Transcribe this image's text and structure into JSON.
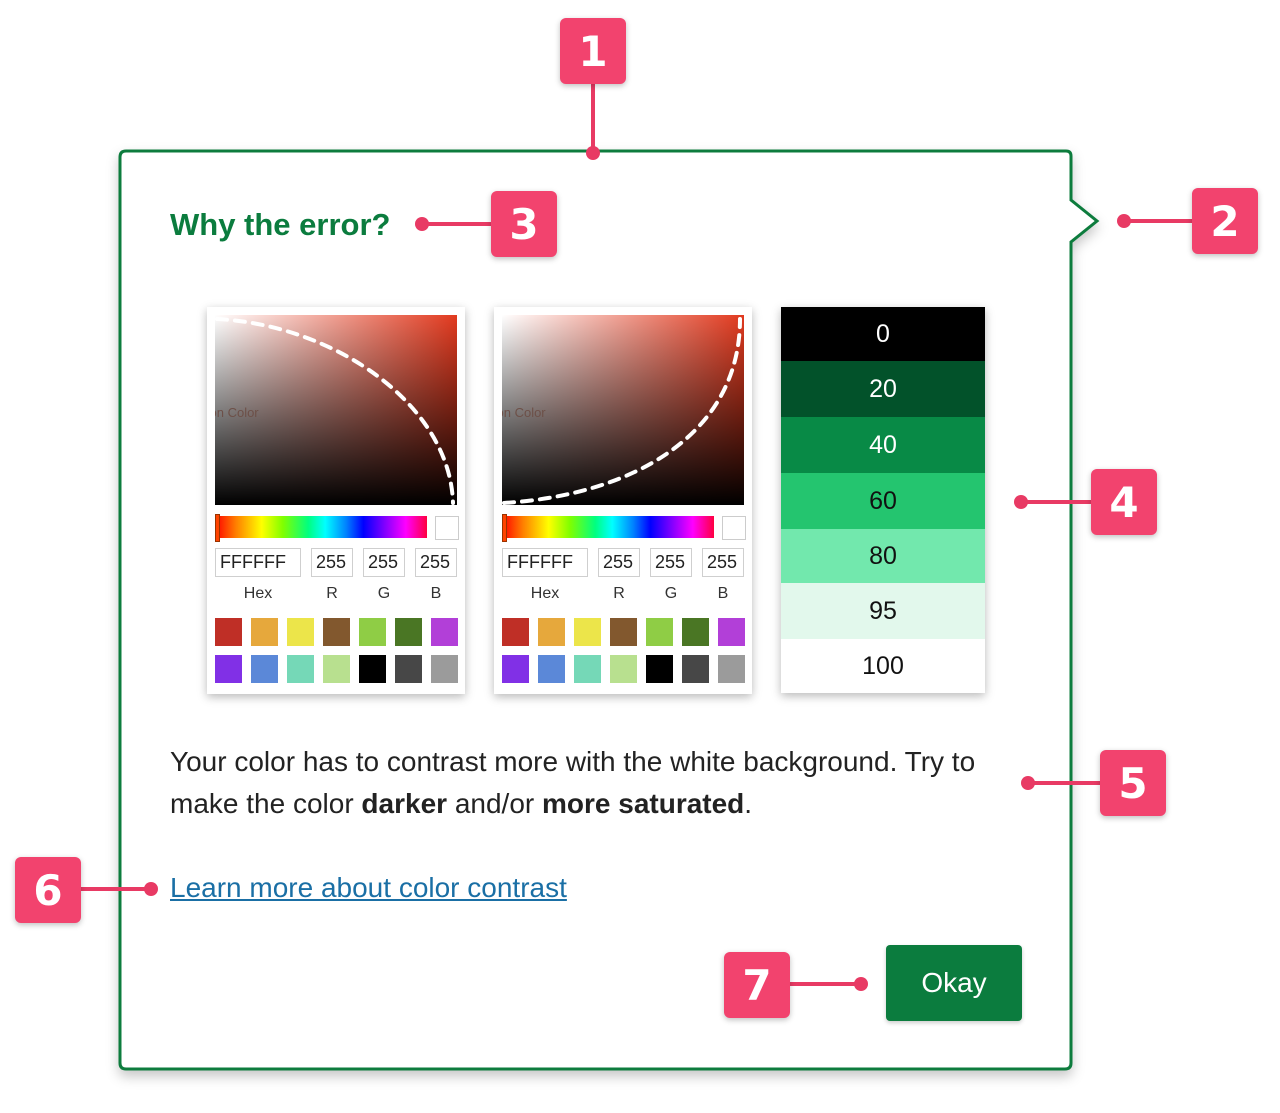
{
  "markers": [
    "1",
    "2",
    "3",
    "4",
    "5",
    "6",
    "7"
  ],
  "dialog": {
    "heading": "Why the error?",
    "body": {
      "part1": "Your color has to contrast more with the white background. Try to make the color ",
      "emph1": "darker",
      "part2": " and/or ",
      "emph2": "more saturated",
      "part3": "."
    },
    "link": "Learn more about color contrast",
    "button": "Okay",
    "accent_color": "#0b7c3e",
    "link_color": "#1a6fa5"
  },
  "pickers": [
    {
      "caption": "con Color",
      "hex": "FFFFFF",
      "r": "255",
      "g": "255",
      "b": "255",
      "labels": {
        "hex": "Hex",
        "r": "R",
        "g": "G",
        "b": "B"
      },
      "swatches": [
        "#bf2f26",
        "#e6a83c",
        "#ece54a",
        "#82582e",
        "#8fcd45",
        "#4a7624",
        "#b23fd8",
        "#8130e6",
        "#5b88d8",
        "#75d8b7",
        "#b8e08f",
        "#000000",
        "#474747",
        "#9b9b9b"
      ]
    },
    {
      "caption": "con Color",
      "hex": "FFFFFF",
      "r": "255",
      "g": "255",
      "b": "255",
      "labels": {
        "hex": "Hex",
        "r": "R",
        "g": "G",
        "b": "B"
      },
      "swatches": [
        "#bf2f26",
        "#e6a83c",
        "#ece54a",
        "#82582e",
        "#8fcd45",
        "#4a7624",
        "#b23fd8",
        "#8130e6",
        "#5b88d8",
        "#75d8b7",
        "#b8e08f",
        "#000000",
        "#474747",
        "#9b9b9b"
      ]
    }
  ],
  "tones": [
    {
      "label": "0",
      "color": "#000000",
      "text": "#ffffff"
    },
    {
      "label": "20",
      "color": "#02522a",
      "text": "#ffffff"
    },
    {
      "label": "40",
      "color": "#088a46",
      "text": "#ffffff"
    },
    {
      "label": "60",
      "color": "#24c56f",
      "text": "#111111"
    },
    {
      "label": "80",
      "color": "#72e8ad",
      "text": "#111111"
    },
    {
      "label": "95",
      "color": "#e2f8ec",
      "text": "#111111"
    },
    {
      "label": "100",
      "color": "#ffffff",
      "text": "#111111"
    }
  ]
}
